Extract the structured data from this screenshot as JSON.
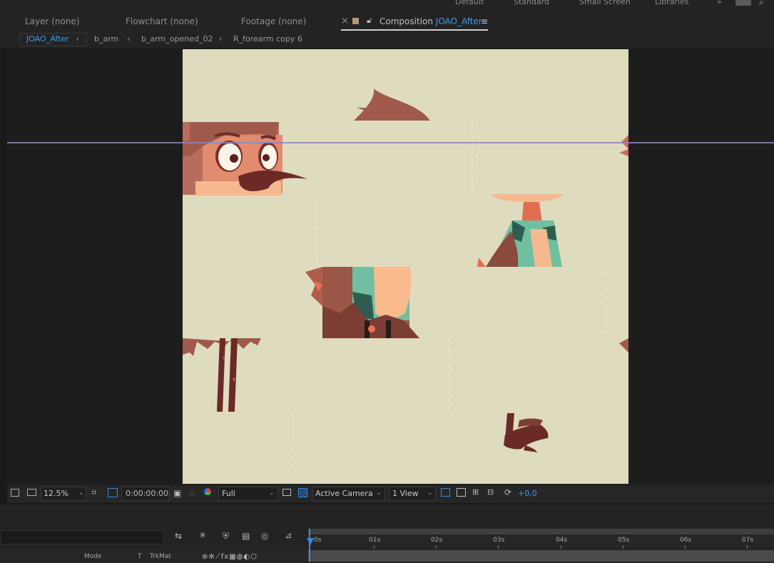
{
  "workspaces": [
    "Default",
    "Standard",
    "Small Screen",
    "Libraries",
    "»"
  ],
  "panel_tabs": {
    "layer": "Layer (none)",
    "flowchart": "Flowchart (none)",
    "footage": "Footage (none)",
    "close": "×",
    "composition_prefix": "Composition",
    "composition_name": "JOAO_After",
    "menu": "≡"
  },
  "breadcrumb": [
    {
      "label": "JOAO_After"
    },
    {
      "label": "b_arm"
    },
    {
      "label": "b_arm_opened_02"
    },
    {
      "label": "R_forearm copy 6"
    }
  ],
  "breadcrumb_separator": "‹",
  "viewer_toolbar": {
    "zoom": "12.5%",
    "timecode": "0:00:00:00",
    "resolution": "Full",
    "camera": "Active Camera",
    "views": "1 View",
    "exposure": "+0,0"
  },
  "timeline": {
    "ruler_labels": [
      "0s",
      "01s",
      "02s",
      "03s",
      "04s",
      "05s",
      "06s",
      "07s"
    ],
    "columns": {
      "mode": "Mode",
      "t": "T",
      "trkmat": "TrkMat"
    }
  },
  "colors": {
    "accent": "#2d8ceb",
    "link_blue": "#3d9be9",
    "canvas_bg": "#dfdbbf",
    "guide": "#8d87b9"
  }
}
